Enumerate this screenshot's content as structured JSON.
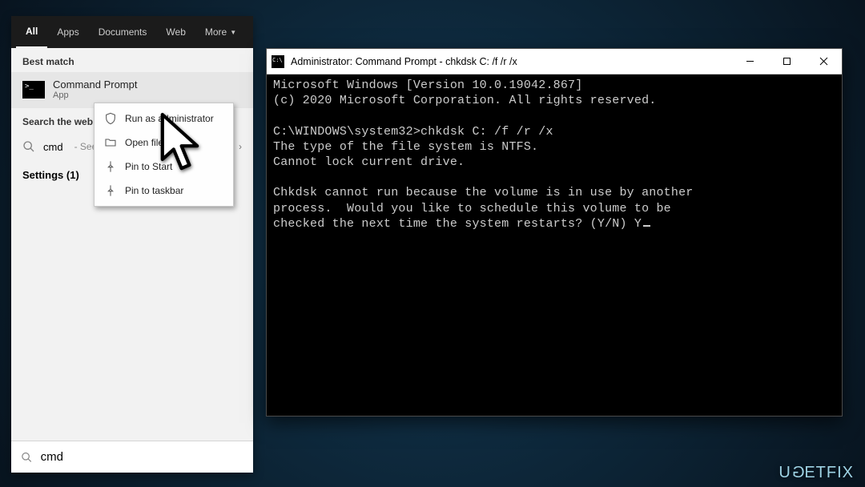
{
  "search": {
    "tabs": {
      "all": "All",
      "apps": "Apps",
      "documents": "Documents",
      "web": "Web",
      "more": "More"
    },
    "best_match_label": "Best match",
    "best_match": {
      "title": "Command Prompt",
      "subtitle": "App"
    },
    "web_label": "Search the web",
    "web_query": "cmd",
    "web_hint": "- See wi",
    "settings_label": "Settings (1)",
    "input_value": "cmd"
  },
  "context_menu": {
    "run_admin": "Run as administrator",
    "open_file": "Open file l",
    "pin_start": "Pin to Start",
    "pin_taskbar": "Pin to taskbar"
  },
  "cmd": {
    "title": "Administrator: Command Prompt - chkdsk  C: /f /r /x",
    "line1": "Microsoft Windows [Version 10.0.19042.867]",
    "line2": "(c) 2020 Microsoft Corporation. All rights reserved.",
    "prompt": "C:\\WINDOWS\\system32>chkdsk C: /f /r /x",
    "line3": "The type of the file system is NTFS.",
    "line4": "Cannot lock current drive.",
    "line5": "Chkdsk cannot run because the volume is in use by another",
    "line6": "process.  Would you like to schedule this volume to be",
    "line7": "checked the next time the system restarts? (Y/N) Y"
  },
  "watermark": "UGETFIX"
}
